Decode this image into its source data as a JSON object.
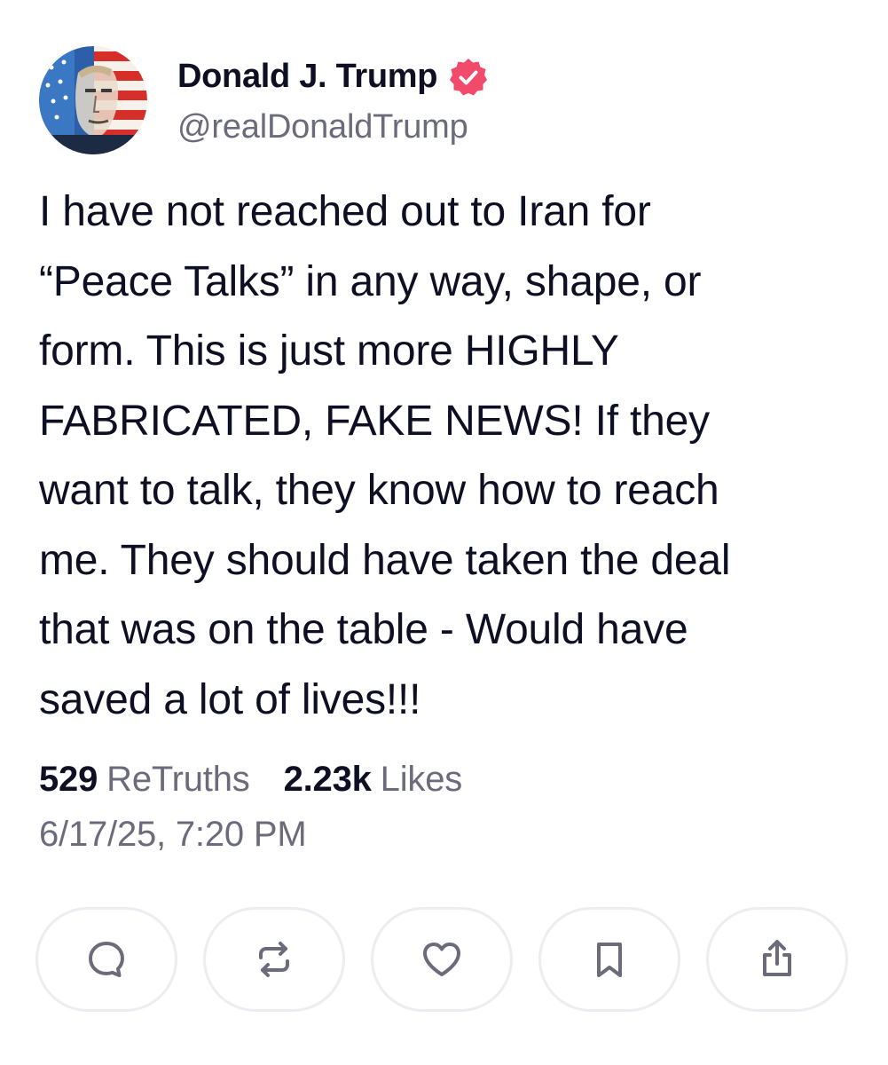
{
  "author": {
    "display_name": "Donald J. Trump",
    "handle": "@realDonaldTrump",
    "verified": true,
    "badge_color": "#f24a6b"
  },
  "post": {
    "text": "I have not reached out to Iran for\n“Peace Talks” in any way, shape, or\nform. This is just more HIGHLY\nFABRICATED, FAKE NEWS! If they\nwant to talk, they know how to reach\nme. They should have taken the deal\nthat was on the table - Would have\nsaved a lot of lives!!!",
    "retruths_count": "529",
    "retruths_label": "ReTruths",
    "likes_count": "2.23k",
    "likes_label": "Likes",
    "timestamp": "6/17/25, 7:20 PM"
  },
  "actions": [
    {
      "name": "reply",
      "icon": "comment-icon"
    },
    {
      "name": "retruth",
      "icon": "repost-icon"
    },
    {
      "name": "like",
      "icon": "heart-icon"
    },
    {
      "name": "bookmark",
      "icon": "bookmark-icon"
    },
    {
      "name": "share",
      "icon": "share-icon"
    }
  ],
  "colors": {
    "text_primary": "#0f0f23",
    "text_secondary": "#6b6b7b",
    "button_border": "#ececf1",
    "icon_color": "#6b6b7b"
  }
}
